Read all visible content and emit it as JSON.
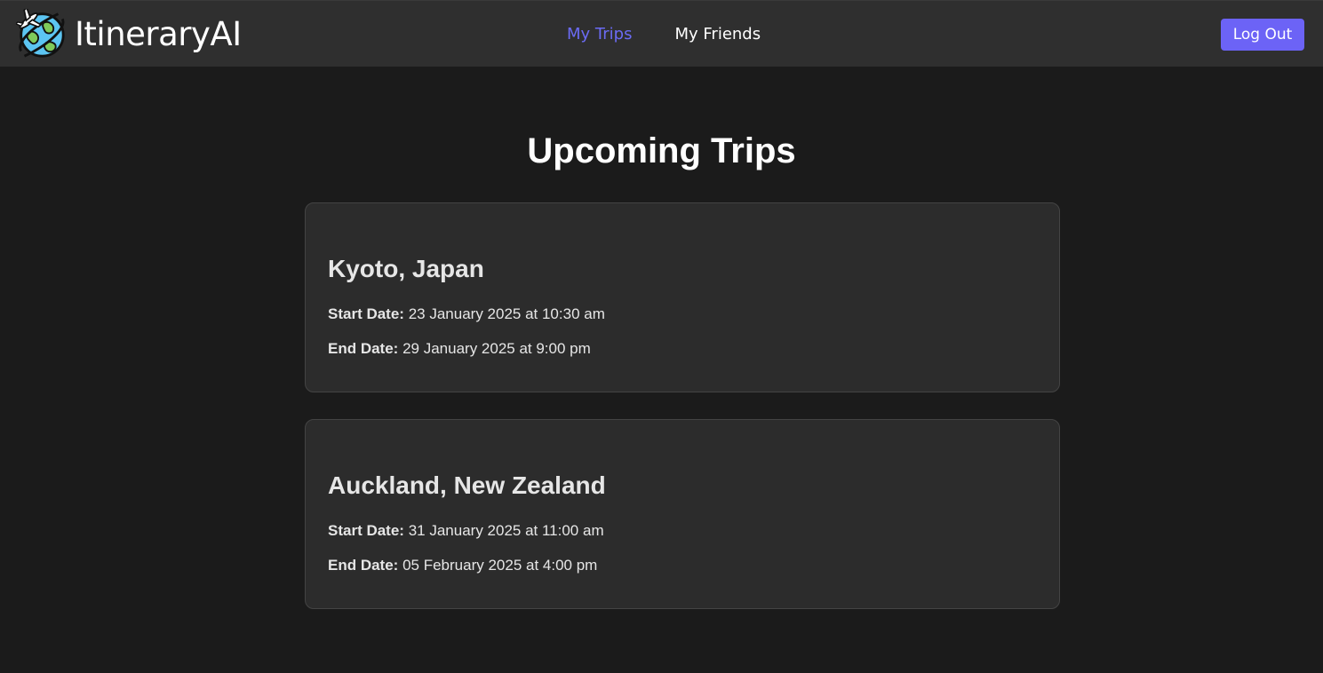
{
  "app": {
    "name": "ItineraryAI",
    "logo_icon": "globe-airplane-icon"
  },
  "nav": {
    "links": [
      {
        "label": "My Trips",
        "active": true
      },
      {
        "label": "My Friends",
        "active": false
      }
    ],
    "logout_label": "Log Out"
  },
  "main": {
    "title": "Upcoming Trips",
    "start_label": "Start Date:",
    "end_label": "End Date:",
    "trips": [
      {
        "destination": "Kyoto, Japan",
        "start": "23 January 2025 at 10:30 am",
        "end": "29 January 2025 at 9:00 pm"
      },
      {
        "destination": "Auckland, New Zealand",
        "start": "31 January 2025 at 11:00 am",
        "end": "05 February 2025 at 4:00 pm"
      }
    ]
  },
  "colors": {
    "background": "#1b1b1b",
    "navbar": "#2f2f2f",
    "accent": "#6c63f6",
    "active_link": "#6b6bf4",
    "card": "#2c2c2c"
  }
}
